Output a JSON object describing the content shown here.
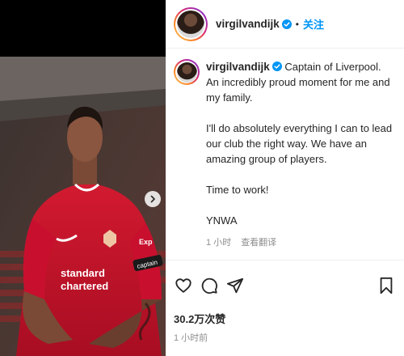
{
  "post": {
    "username": "virgilvandijk",
    "separator": "•",
    "follow_label": "关注",
    "caption": {
      "username": "virgilvandijk",
      "lines": [
        "Captain of Liverpool. An incredibly proud moment for me and my family.",
        "I'll do absolutely everything I can to lead our club the right way. We have an amazing group of players.",
        "Time to work!",
        "YNWA"
      ],
      "time_ago": "1 小时",
      "see_translation": "查看翻译"
    },
    "likes": "30.2万次赞",
    "posted": "1 小时前"
  },
  "photo": {
    "sponsor": "standard chartered",
    "sleeve_badge": "Expedia",
    "captain_band": "captain"
  },
  "icons": [
    "verified-badge-icon",
    "chevron-right-icon",
    "heart-icon",
    "comment-icon",
    "share-icon",
    "bookmark-icon"
  ],
  "colors": {
    "accent": "#0095f6",
    "jersey": "#c8102e",
    "muted": "#8e8e8e"
  }
}
